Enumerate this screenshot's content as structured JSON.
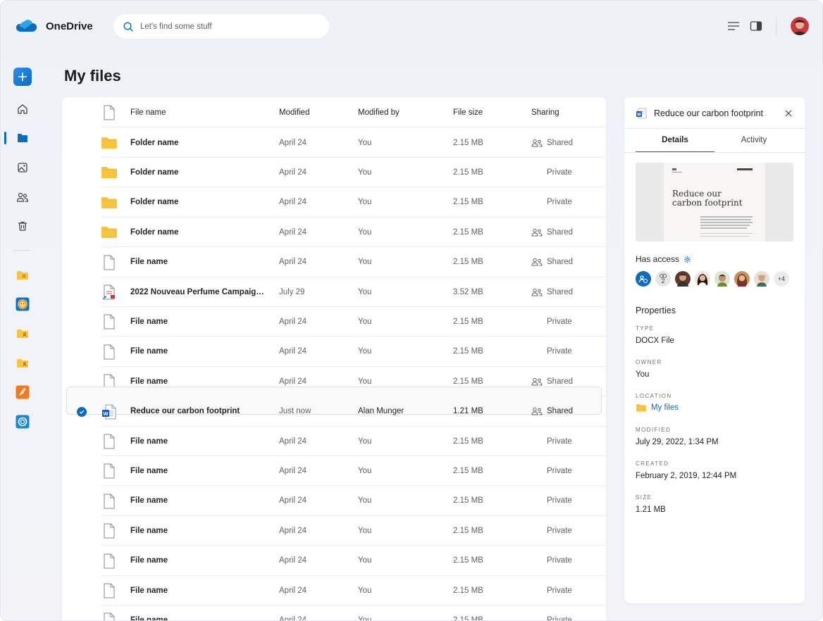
{
  "app": {
    "name": "OneDrive"
  },
  "search": {
    "placeholder": "Let's find some stuff"
  },
  "page": {
    "title": "My files"
  },
  "table": {
    "headers": {
      "name": "File name",
      "modified": "Modified",
      "modified_by": "Modified by",
      "size": "File size",
      "sharing": "Sharing"
    },
    "rows": [
      {
        "type": "folder",
        "name": "Folder name",
        "modified": "April 24",
        "by": "You",
        "size": "2.15 MB",
        "sharing": "Shared"
      },
      {
        "type": "folder",
        "name": "Folder name",
        "modified": "April 24",
        "by": "You",
        "size": "2.15 MB",
        "sharing": "Private"
      },
      {
        "type": "folder",
        "name": "Folder name",
        "modified": "April 24",
        "by": "You",
        "size": "2.15 MB",
        "sharing": "Private"
      },
      {
        "type": "folder",
        "name": "Folder name",
        "modified": "April 24",
        "by": "You",
        "size": "2.15 MB",
        "sharing": "Shared"
      },
      {
        "type": "file",
        "name": "File name",
        "modified": "April 24",
        "by": "You",
        "size": "2.15 MB",
        "sharing": "Shared"
      },
      {
        "type": "pdf",
        "name": "2022 Nouveau Perfume Campaign...",
        "modified": "July 29",
        "by": "You",
        "size": "3.52 MB",
        "sharing": "Shared"
      },
      {
        "type": "file",
        "name": "File name",
        "modified": "April 24",
        "by": "You",
        "size": "2.15 MB",
        "sharing": "Private"
      },
      {
        "type": "file",
        "name": "File name",
        "modified": "April 24",
        "by": "You",
        "size": "2.15 MB",
        "sharing": "Private"
      },
      {
        "type": "file",
        "name": "File name",
        "modified": "April 24",
        "by": "You",
        "size": "2.15 MB",
        "sharing": "Shared"
      },
      {
        "type": "word",
        "name": "Reduce our carbon footprint",
        "modified": "Just now",
        "by": "Alan Munger",
        "size": "1.21 MB",
        "sharing": "Shared",
        "selected": true
      },
      {
        "type": "file",
        "name": "File name",
        "modified": "April 24",
        "by": "You",
        "size": "2.15 MB",
        "sharing": "Private"
      },
      {
        "type": "file",
        "name": "File name",
        "modified": "April 24",
        "by": "You",
        "size": "2.15 MB",
        "sharing": "Private"
      },
      {
        "type": "file",
        "name": "File name",
        "modified": "April 24",
        "by": "You",
        "size": "2.15 MB",
        "sharing": "Private"
      },
      {
        "type": "file",
        "name": "File name",
        "modified": "April 24",
        "by": "You",
        "size": "2.15 MB",
        "sharing": "Private"
      },
      {
        "type": "file",
        "name": "File name",
        "modified": "April 24",
        "by": "You",
        "size": "2.15 MB",
        "sharing": "Private"
      },
      {
        "type": "file",
        "name": "File name",
        "modified": "April 24",
        "by": "You",
        "size": "2.15 MB",
        "sharing": "Private"
      },
      {
        "type": "file",
        "name": "File name",
        "modified": "April 24",
        "by": "You",
        "size": "2.15 MB",
        "sharing": "Private"
      }
    ]
  },
  "details": {
    "title": "Reduce our carbon footprint",
    "tabs": [
      "Details",
      "Activity"
    ],
    "preview_heading": [
      "Reduce our",
      "carbon footprint"
    ],
    "has_access_label": "Has access",
    "link_count": "2",
    "more_people": "+4",
    "properties_title": "Properties",
    "properties": [
      {
        "label": "Type",
        "value": "DOCX File"
      },
      {
        "label": "Owner",
        "value": "You"
      },
      {
        "label": "Location",
        "value": "My files",
        "link": true
      },
      {
        "label": "Modified",
        "value": "July 29, 2022, 1:34 PM"
      },
      {
        "label": "Created",
        "value": "February 2, 2019, 12:44 PM"
      },
      {
        "label": "Size",
        "value": "1.21 MB"
      }
    ]
  },
  "colors": {
    "accent": "#0f6cbd",
    "folder": "#f8c43f"
  }
}
